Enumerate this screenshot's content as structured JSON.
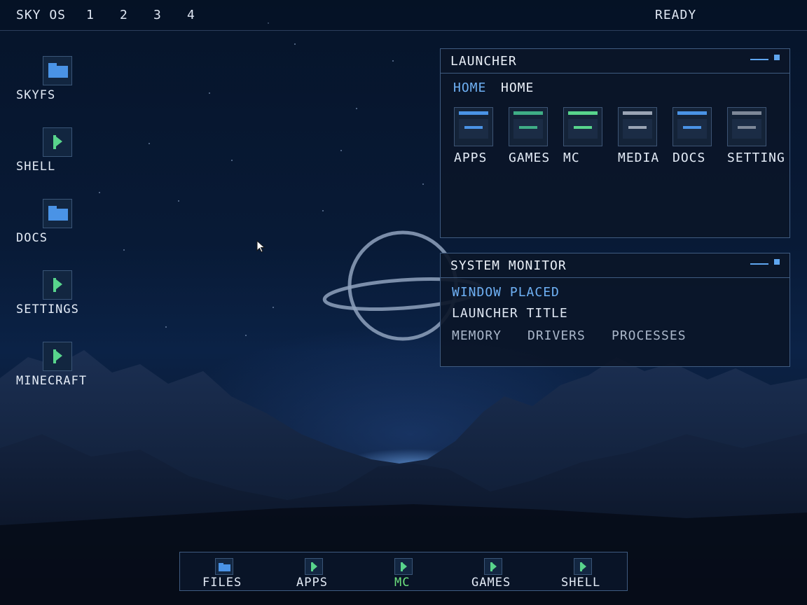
{
  "topbar": {
    "os_name": "SKY OS",
    "workspaces": [
      "1",
      "2",
      "3",
      "4"
    ],
    "status": "READY"
  },
  "desktop_icons": [
    {
      "label": "SKYFS",
      "icon": "folder-icon"
    },
    {
      "label": "SHELL",
      "icon": "flag-icon"
    },
    {
      "label": "DOCS",
      "icon": "folder-icon"
    },
    {
      "label": "SETTINGS",
      "icon": "flag-icon"
    },
    {
      "label": "MINECRAFT",
      "icon": "flag-icon"
    }
  ],
  "launcher": {
    "title": "LAUNCHER",
    "breadcrumb": [
      "HOME",
      "HOME"
    ],
    "items": [
      {
        "label": "APPS",
        "accent": "#4a93e6"
      },
      {
        "label": "GAMES",
        "accent": "#3fae86"
      },
      {
        "label": "MC",
        "accent": "#58d48c"
      },
      {
        "label": "MEDIA",
        "accent": "#9aa4b4"
      },
      {
        "label": "DOCS",
        "accent": "#4a93e6"
      },
      {
        "label": "SETTING",
        "accent": "#7e8898"
      }
    ]
  },
  "system_monitor": {
    "title": "SYSTEM MONITOR",
    "line1": "WINDOW PLACED",
    "line2": "LAUNCHER TITLE",
    "tabs": [
      "MEMORY",
      "DRIVERS",
      "PROCESSES"
    ]
  },
  "dock": {
    "items": [
      {
        "label": "FILES",
        "icon": "folder-icon",
        "active": false
      },
      {
        "label": "APPS",
        "icon": "flag-icon",
        "active": false
      },
      {
        "label": "MC",
        "icon": "flag-icon",
        "active": true
      },
      {
        "label": "GAMES",
        "icon": "flag-icon",
        "active": false
      },
      {
        "label": "SHELL",
        "icon": "flag-icon",
        "active": false
      }
    ]
  },
  "colors": {
    "accent_blue": "#5fa6ef",
    "accent_green": "#6ee37f",
    "window_border": "#3f5b80",
    "background": "#061226"
  }
}
